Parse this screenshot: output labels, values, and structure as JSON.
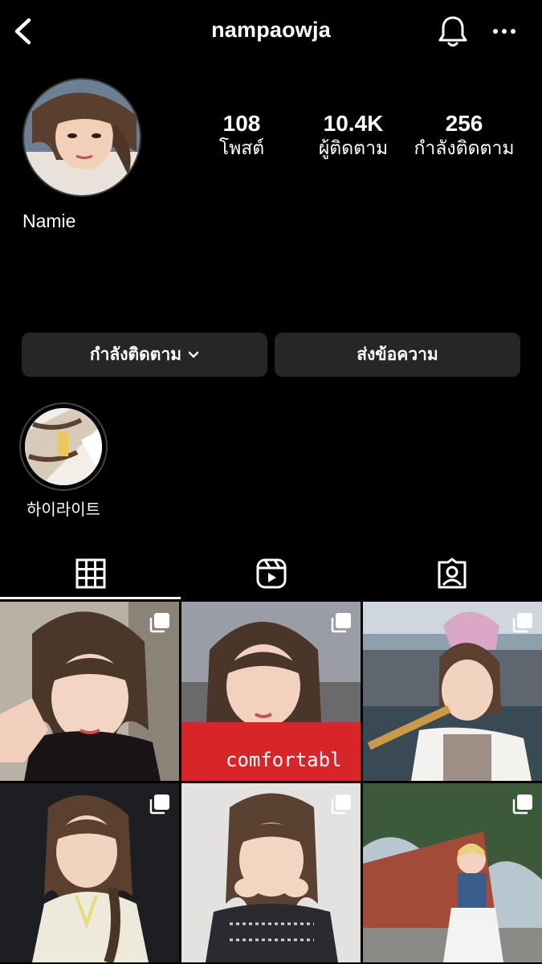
{
  "header": {
    "username": "nampaowja"
  },
  "profile": {
    "display_name": "Namie",
    "stats": [
      {
        "value": "108",
        "label": "โพสต์"
      },
      {
        "value": "10.4K",
        "label": "ผู้ติดตาม"
      },
      {
        "value": "256",
        "label": "กำลังติดตาม"
      }
    ]
  },
  "actions": {
    "following_label": "กำลังติดตาม",
    "message_label": "ส่งข้อความ"
  },
  "highlights": [
    {
      "label": "하이라이트"
    }
  ],
  "tabs": [
    {
      "icon": "grid-icon",
      "active": true
    },
    {
      "icon": "reels-icon",
      "active": false
    },
    {
      "icon": "tagged-icon",
      "active": false
    }
  ],
  "posts": [
    {
      "caption": "",
      "multi": true
    },
    {
      "caption": "comfortabl",
      "multi": true
    },
    {
      "caption": "",
      "multi": true
    },
    {
      "caption": "",
      "multi": true
    },
    {
      "caption": "",
      "multi": true
    },
    {
      "caption": "",
      "multi": true
    }
  ],
  "colors": {
    "background": "#000000",
    "button": "#262626",
    "text": "#ffffff"
  }
}
